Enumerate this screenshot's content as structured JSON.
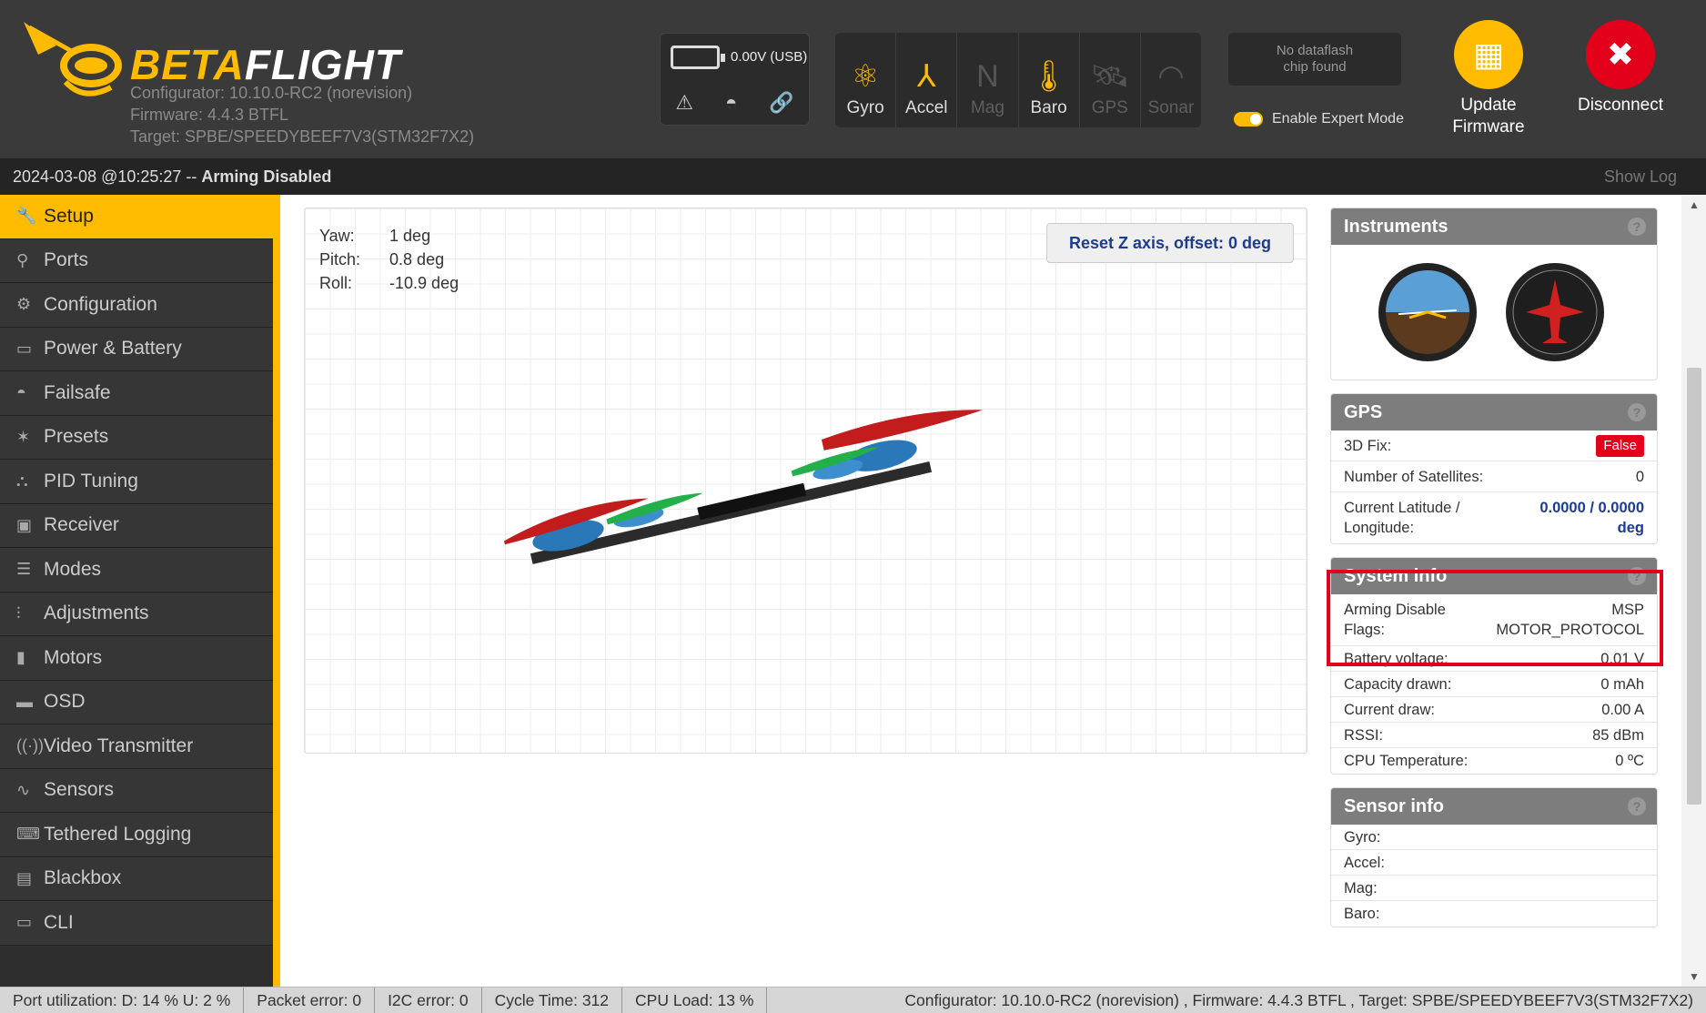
{
  "header": {
    "brand_a": "BETA",
    "brand_b": "FLIGHT",
    "configurator": "Configurator: 10.10.0-RC2 (norevision)",
    "firmware": "Firmware: 4.4.3 BTFL",
    "target": "Target: SPBE/SPEEDYBEEF7V3(STM32F7X2)",
    "battery": "0.00V (USB)",
    "sensors": [
      {
        "label": "Gyro",
        "icon": "gyro-icon",
        "glyph": "⚛",
        "on": true
      },
      {
        "label": "Accel",
        "icon": "accel-icon",
        "glyph": "⅄",
        "on": true
      },
      {
        "label": "Mag",
        "icon": "mag-icon",
        "glyph": "N",
        "on": false
      },
      {
        "label": "Baro",
        "icon": "baro-icon",
        "glyph": "🌡",
        "on": true
      },
      {
        "label": "GPS",
        "icon": "gps-icon",
        "glyph": "🛰",
        "on": false
      },
      {
        "label": "Sonar",
        "icon": "sonar-icon",
        "glyph": "◠",
        "on": false
      }
    ],
    "dataflash_1": "No dataflash",
    "dataflash_2": "chip found",
    "expert_mode": "Enable Expert Mode",
    "update_1": "Update",
    "update_2": "Firmware",
    "disconnect": "Disconnect"
  },
  "status": {
    "time": "2024-03-08 @10:25:27 -- ",
    "state": "Arming Disabled",
    "show_log": "Show Log"
  },
  "sidebar": {
    "items": [
      {
        "label": "Setup",
        "icon": "wrench-icon",
        "glyph": "🔧"
      },
      {
        "label": "Ports",
        "icon": "plug-icon",
        "glyph": "⚲"
      },
      {
        "label": "Configuration",
        "icon": "gear-icon",
        "glyph": "⚙"
      },
      {
        "label": "Power & Battery",
        "icon": "battery-icon",
        "glyph": "▭"
      },
      {
        "label": "Failsafe",
        "icon": "parachute-icon",
        "glyph": "◓"
      },
      {
        "label": "Presets",
        "icon": "wand-icon",
        "glyph": "✶"
      },
      {
        "label": "PID Tuning",
        "icon": "pid-icon",
        "glyph": "⛬"
      },
      {
        "label": "Receiver",
        "icon": "receiver-icon",
        "glyph": "▣"
      },
      {
        "label": "Modes",
        "icon": "toggles-icon",
        "glyph": "☰"
      },
      {
        "label": "Adjustments",
        "icon": "sliders-icon",
        "glyph": "⫶"
      },
      {
        "label": "Motors",
        "icon": "motor-icon",
        "glyph": "▮"
      },
      {
        "label": "OSD",
        "icon": "osd-icon",
        "glyph": "▬"
      },
      {
        "label": "Video Transmitter",
        "icon": "antenna-icon",
        "glyph": "((·))"
      },
      {
        "label": "Sensors",
        "icon": "pulse-icon",
        "glyph": "∿"
      },
      {
        "label": "Tethered Logging",
        "icon": "keyboard-icon",
        "glyph": "⌨"
      },
      {
        "label": "Blackbox",
        "icon": "blackbox-icon",
        "glyph": "▤"
      },
      {
        "label": "CLI",
        "icon": "terminal-icon",
        "glyph": "▭"
      }
    ]
  },
  "attitude": {
    "yaw_label": "Yaw:",
    "yaw": "1 deg",
    "pitch_label": "Pitch:",
    "pitch": "0.8 deg",
    "roll_label": "Roll:",
    "roll": "-10.9 deg",
    "reset": "Reset Z axis, offset: 0 deg"
  },
  "instruments": {
    "title": "Instruments"
  },
  "gps": {
    "title": "GPS",
    "fix_label": "3D Fix:",
    "fix": "False",
    "sats_label": "Number of Satellites:",
    "sats": "0",
    "latlon_label_1": "Current Latitude /",
    "latlon_label_2": "Longitude:",
    "latlon_1": "0.0000 / 0.0000",
    "latlon_2": "deg"
  },
  "sysinfo": {
    "title": "System info",
    "arm_label_1": "Arming Disable",
    "arm_label_2": "Flags:",
    "arm_1": "MSP",
    "arm_2": "MOTOR_PROTOCOL",
    "rows": [
      {
        "label": "Battery voltage:",
        "value": "0.01 V"
      },
      {
        "label": "Capacity drawn:",
        "value": "0 mAh"
      },
      {
        "label": "Current draw:",
        "value": "0.00 A"
      },
      {
        "label": "RSSI:",
        "value": "85 dBm"
      },
      {
        "label": "CPU Temperature:",
        "value": "0 ºC"
      }
    ]
  },
  "sensorinfo": {
    "title": "Sensor info",
    "rows": [
      {
        "label": "Gyro:"
      },
      {
        "label": "Accel:"
      },
      {
        "label": "Mag:"
      },
      {
        "label": "Baro:"
      }
    ]
  },
  "footer": {
    "port": "Port utilization: D: 14 % U: 2 %",
    "packet": "Packet error: 0",
    "i2c": "I2C error: 0",
    "cycle": "Cycle Time: 312",
    "cpu": "CPU Load: 13 %",
    "info": "Configurator: 10.10.0-RC2 (norevision) , Firmware: 4.4.3 BTFL , Target: SPBE/SPEEDYBEEF7V3(STM32F7X2)"
  },
  "colors": {
    "accent": "#ffbb00",
    "danger": "#e2001a",
    "link": "#1d3c8f"
  }
}
